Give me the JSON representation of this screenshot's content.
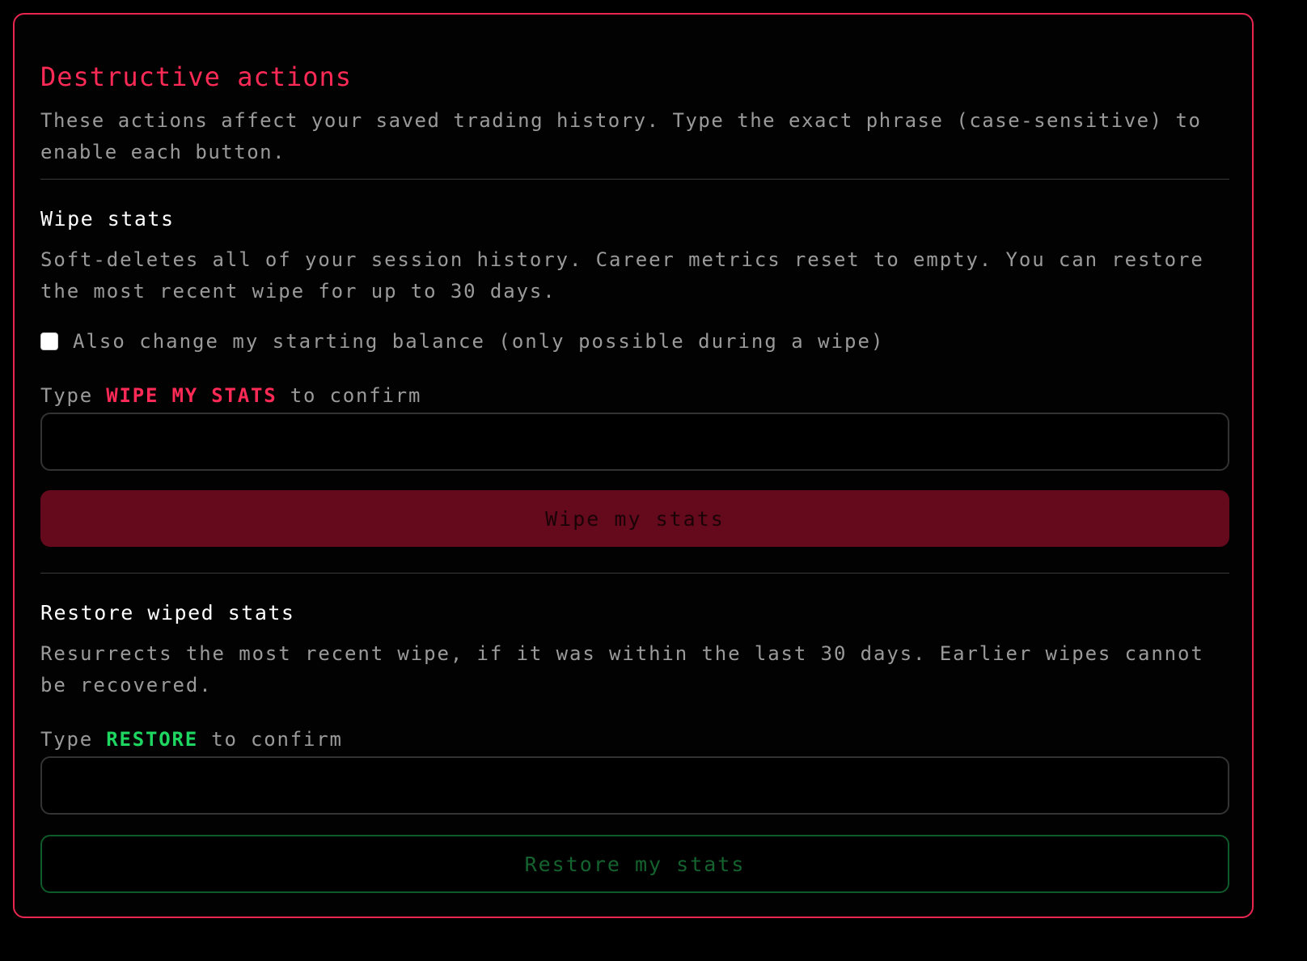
{
  "panel": {
    "title": "Destructive actions",
    "intro": "These actions affect your saved trading history. Type the exact phrase (case-sensitive) to enable each button."
  },
  "wipe": {
    "title": "Wipe stats",
    "description": "Soft-deletes all of your session history. Career metrics reset to empty. You can restore the most recent wipe for up to 30 days.",
    "checkbox_label": "Also change my starting balance (only possible during a wipe)",
    "checkbox_checked": false,
    "confirm_prefix": "Type",
    "confirm_phrase": "WIPE MY STATS",
    "confirm_suffix": "to confirm",
    "input_value": "",
    "button_label": "Wipe my stats"
  },
  "restore": {
    "title": "Restore wiped stats",
    "description": "Resurrects the most recent wipe, if it was within the last 30 days. Earlier wipes cannot be recovered.",
    "confirm_prefix": "Type",
    "confirm_phrase": "RESTORE",
    "confirm_suffix": "to confirm",
    "input_value": "",
    "button_label": "Restore my stats"
  },
  "colors": {
    "danger": "#ff2a55",
    "success": "#1ed760",
    "panel_border": "#e8264f",
    "muted_text": "#9a9a9a",
    "wipe_button_bg": "#640a1c",
    "restore_button_border": "#0f5a2a"
  }
}
